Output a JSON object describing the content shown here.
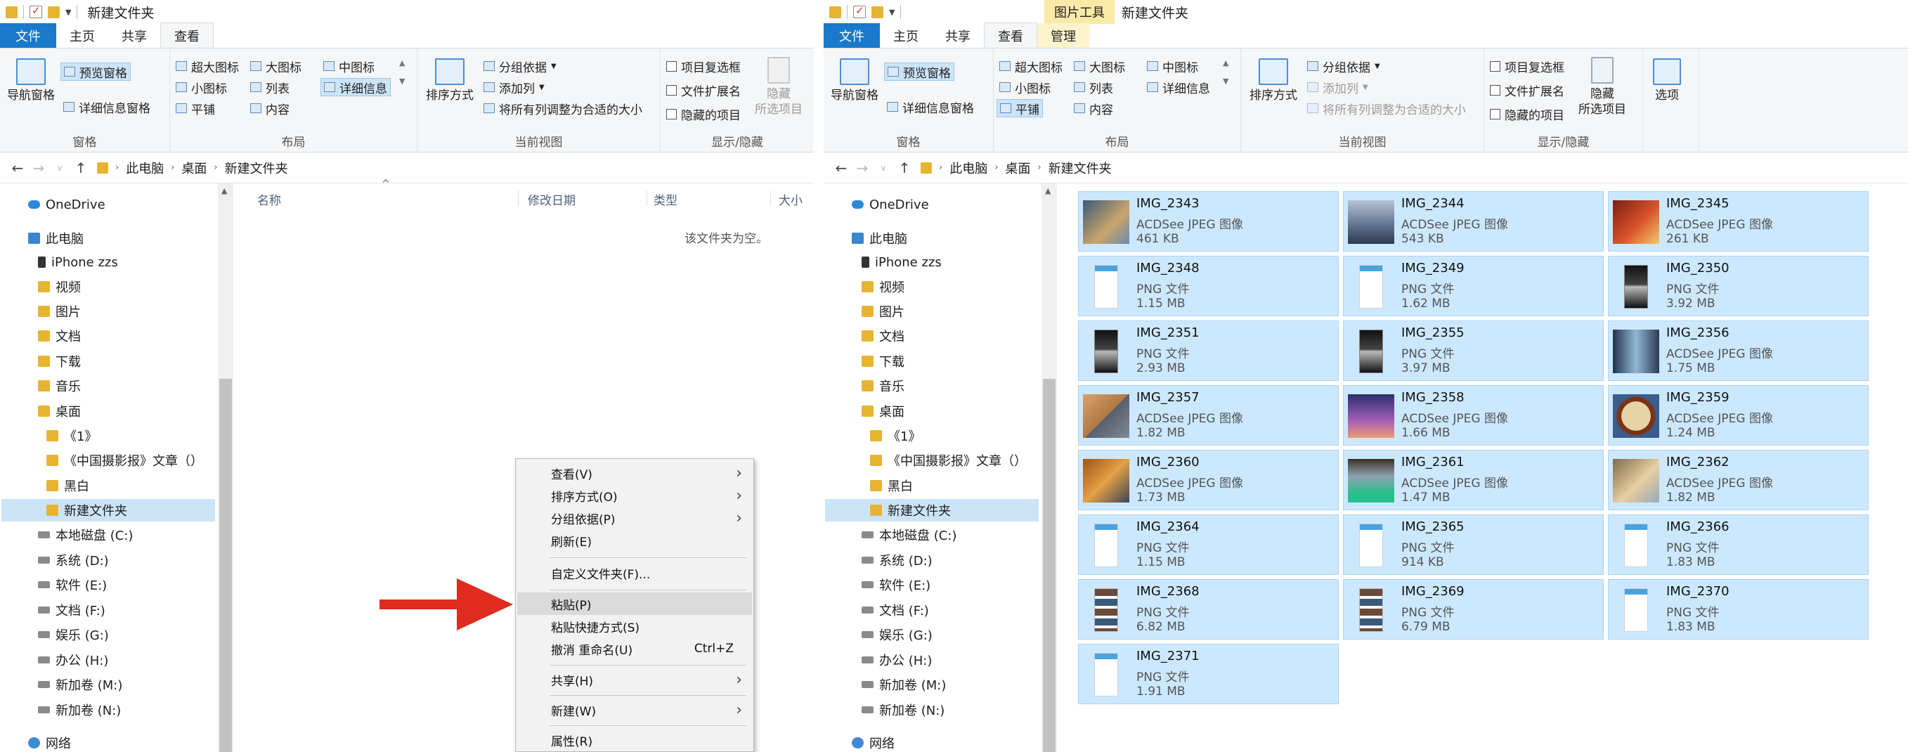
{
  "left": {
    "title": "新建文件夹",
    "tabs": [
      "文件",
      "主页",
      "共享",
      "查看"
    ],
    "ribbon": {
      "pane": {
        "nav": "导航窗格",
        "preview": "预览窗格",
        "details": "详细信息窗格",
        "label": "窗格"
      },
      "layout": {
        "xl": "超大图标",
        "large": "大图标",
        "medium": "中图标",
        "small": "小图标",
        "list": "列表",
        "details": "详细信息",
        "tiles": "平铺",
        "content": "内容",
        "label": "布局"
      },
      "view": {
        "sort": "排序方式",
        "group": "分组依据",
        "addcol": "添加列",
        "fit": "将所有列调整为合适的大小",
        "label": "当前视图"
      },
      "show": {
        "chk": "项目复选框",
        "ext": "文件扩展名",
        "hidden": "隐藏的项目",
        "hide1": "隐藏",
        "hide2": "所选项目",
        "label": "显示/隐藏"
      }
    },
    "breadcrumb": [
      "此电脑",
      "桌面",
      "新建文件夹"
    ],
    "columns": [
      "名称",
      "修改日期",
      "类型",
      "大小"
    ],
    "empty_text": "该文件夹为空。",
    "context_menu": {
      "view": "查看(V)",
      "sort": "排序方式(O)",
      "group": "分组依据(P)",
      "refresh": "刷新(E)",
      "customize": "自定义文件夹(F)...",
      "paste": "粘贴(P)",
      "paste_shortcut": "粘贴快捷方式(S)",
      "undo": "撤消 重命名(U)",
      "undo_key": "Ctrl+Z",
      "share": "共享(H)",
      "new": "新建(W)",
      "props": "属性(R)"
    }
  },
  "right": {
    "title": "新建文件夹",
    "tool_tab": "图片工具",
    "tabs": [
      "文件",
      "主页",
      "共享",
      "查看",
      "管理"
    ],
    "ribbon": {
      "show": {
        "hide1": "隐藏",
        "hide2": "所选项目"
      },
      "options": "选项"
    },
    "files": [
      {
        "name": "IMG_2343",
        "type": "ACDSee JPEG 图像",
        "size": "461 KB"
      },
      {
        "name": "IMG_2344",
        "type": "ACDSee JPEG 图像",
        "size": "543 KB"
      },
      {
        "name": "IMG_2345",
        "type": "ACDSee JPEG 图像",
        "size": "261 KB"
      },
      {
        "name": "IMG_2348",
        "type": "PNG 文件",
        "size": "1.15 MB"
      },
      {
        "name": "IMG_2349",
        "type": "PNG 文件",
        "size": "1.62 MB"
      },
      {
        "name": "IMG_2350",
        "type": "PNG 文件",
        "size": "3.92 MB"
      },
      {
        "name": "IMG_2351",
        "type": "PNG 文件",
        "size": "2.93 MB"
      },
      {
        "name": "IMG_2355",
        "type": "PNG 文件",
        "size": "3.97 MB"
      },
      {
        "name": "IMG_2356",
        "type": "ACDSee JPEG 图像",
        "size": "1.75 MB"
      },
      {
        "name": "IMG_2357",
        "type": "ACDSee JPEG 图像",
        "size": "1.82 MB"
      },
      {
        "name": "IMG_2358",
        "type": "ACDSee JPEG 图像",
        "size": "1.66 MB"
      },
      {
        "name": "IMG_2359",
        "type": "ACDSee JPEG 图像",
        "size": "1.24 MB"
      },
      {
        "name": "IMG_2360",
        "type": "ACDSee JPEG 图像",
        "size": "1.73 MB"
      },
      {
        "name": "IMG_2361",
        "type": "ACDSee JPEG 图像",
        "size": "1.47 MB"
      },
      {
        "name": "IMG_2362",
        "type": "ACDSee JPEG 图像",
        "size": "1.82 MB"
      },
      {
        "name": "IMG_2364",
        "type": "PNG 文件",
        "size": "1.15 MB"
      },
      {
        "name": "IMG_2365",
        "type": "PNG 文件",
        "size": "914 KB"
      },
      {
        "name": "IMG_2366",
        "type": "PNG 文件",
        "size": "1.83 MB"
      },
      {
        "name": "IMG_2368",
        "type": "PNG 文件",
        "size": "6.82 MB"
      },
      {
        "name": "IMG_2369",
        "type": "PNG 文件",
        "size": "6.79 MB"
      },
      {
        "name": "IMG_2370",
        "type": "PNG 文件",
        "size": "1.83 MB"
      },
      {
        "name": "IMG_2371",
        "type": "PNG 文件",
        "size": "1.91 MB"
      }
    ]
  },
  "sidebar": [
    {
      "label": "OneDrive",
      "icon": "cloud-icon"
    },
    {
      "label": "此电脑",
      "icon": "pc-icon"
    },
    {
      "label": "iPhone zzs",
      "icon": "phone-icon"
    },
    {
      "label": "视频",
      "icon": "folder-icon"
    },
    {
      "label": "图片",
      "icon": "folder-icon"
    },
    {
      "label": "文档",
      "icon": "folder-icon"
    },
    {
      "label": "下载",
      "icon": "folder-icon"
    },
    {
      "label": "音乐",
      "icon": "folder-icon"
    },
    {
      "label": "桌面",
      "icon": "folder-icon"
    },
    {
      "label": "《1》",
      "icon": "folder-icon"
    },
    {
      "label": "《中国摄影报》文章（）",
      "icon": "folder-icon"
    },
    {
      "label": "黑白",
      "icon": "folder-icon"
    },
    {
      "label": "新建文件夹",
      "icon": "folder-icon"
    },
    {
      "label": "本地磁盘 (C:)",
      "icon": "drive-icon"
    },
    {
      "label": "系统 (D:)",
      "icon": "drive-icon"
    },
    {
      "label": "软件 (E:)",
      "icon": "drive-icon"
    },
    {
      "label": "文档 (F:)",
      "icon": "drive-icon"
    },
    {
      "label": "娱乐 (G:)",
      "icon": "drive-icon"
    },
    {
      "label": "办公 (H:)",
      "icon": "drive-icon"
    },
    {
      "label": "新加卷 (M:)",
      "icon": "drive-icon"
    },
    {
      "label": "新加卷 (N:)",
      "icon": "drive-icon"
    },
    {
      "label": "网络",
      "icon": "network-icon"
    }
  ],
  "colors": {
    "accent": "#1979ca",
    "selection": "#cce8ff",
    "arrow": "#e02b1f"
  }
}
